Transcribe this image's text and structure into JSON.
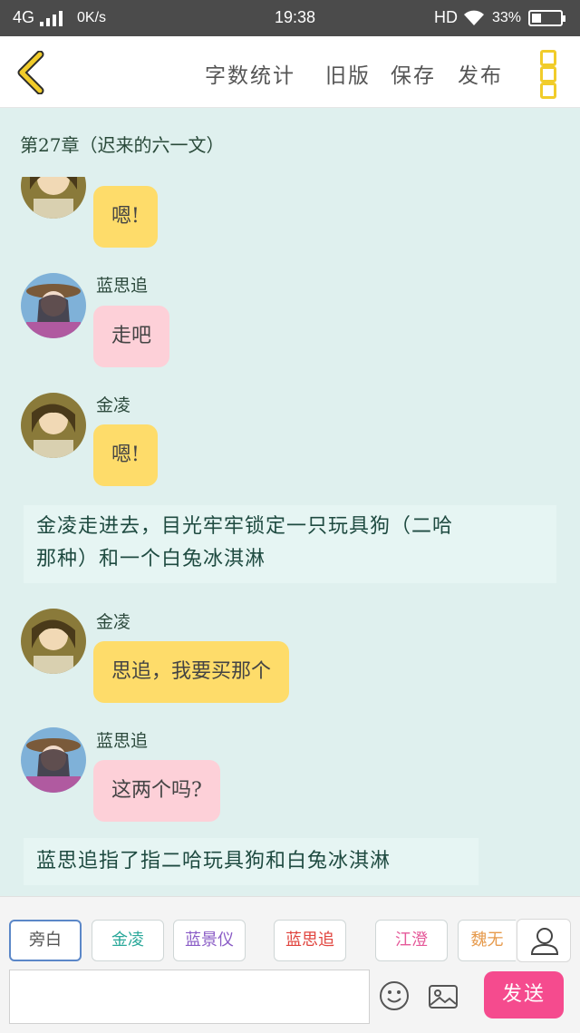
{
  "status": {
    "network": "4G",
    "speed": "0K/s",
    "time": "19:38",
    "hd": "HD",
    "battery": "33%",
    "battery_level": 0.33
  },
  "toolbar": {
    "word_count": "字数统计",
    "old_version": "旧版",
    "save": "保存",
    "publish": "发布"
  },
  "chapter_title": "第27章（迟来的六一文）",
  "messages": [
    {
      "speaker": "",
      "text": "嗯!",
      "color": "yellow"
    },
    {
      "speaker": "蓝思追",
      "text": "走吧",
      "color": "pink"
    },
    {
      "speaker": "金凌",
      "text": "嗯!",
      "color": "yellow"
    },
    {
      "narration": [
        "金凌走进去，目光牢牢锁定一只玩具狗（二哈",
        "那种）和一个白兔冰淇淋"
      ]
    },
    {
      "speaker": "金凌",
      "text": "思追，我要买那个",
      "color": "yellow"
    },
    {
      "speaker": "蓝思追",
      "text": "这两个吗?",
      "color": "pink"
    },
    {
      "narration": [
        "蓝思追指了指二哈玩具狗和白兔冰淇淋"
      ]
    }
  ],
  "roles": [
    {
      "label": "旁白",
      "color": "#555555"
    },
    {
      "label": "金凌",
      "color": "#2aa89a"
    },
    {
      "label": "蓝景仪",
      "color": "#8a5cc6"
    },
    {
      "label": "蓝思追",
      "color": "#e0443e"
    },
    {
      "label": "江澄",
      "color": "#e55a9a"
    },
    {
      "label": "魏无",
      "color": "#e69a4c"
    }
  ],
  "send_label": "发送",
  "colors": {
    "background": "#dff0ee",
    "bubble_yellow": "#fedc6a",
    "bubble_pink": "#fdd0d8",
    "send": "#f54b8e",
    "accent_icon": "#f1cc2a"
  }
}
